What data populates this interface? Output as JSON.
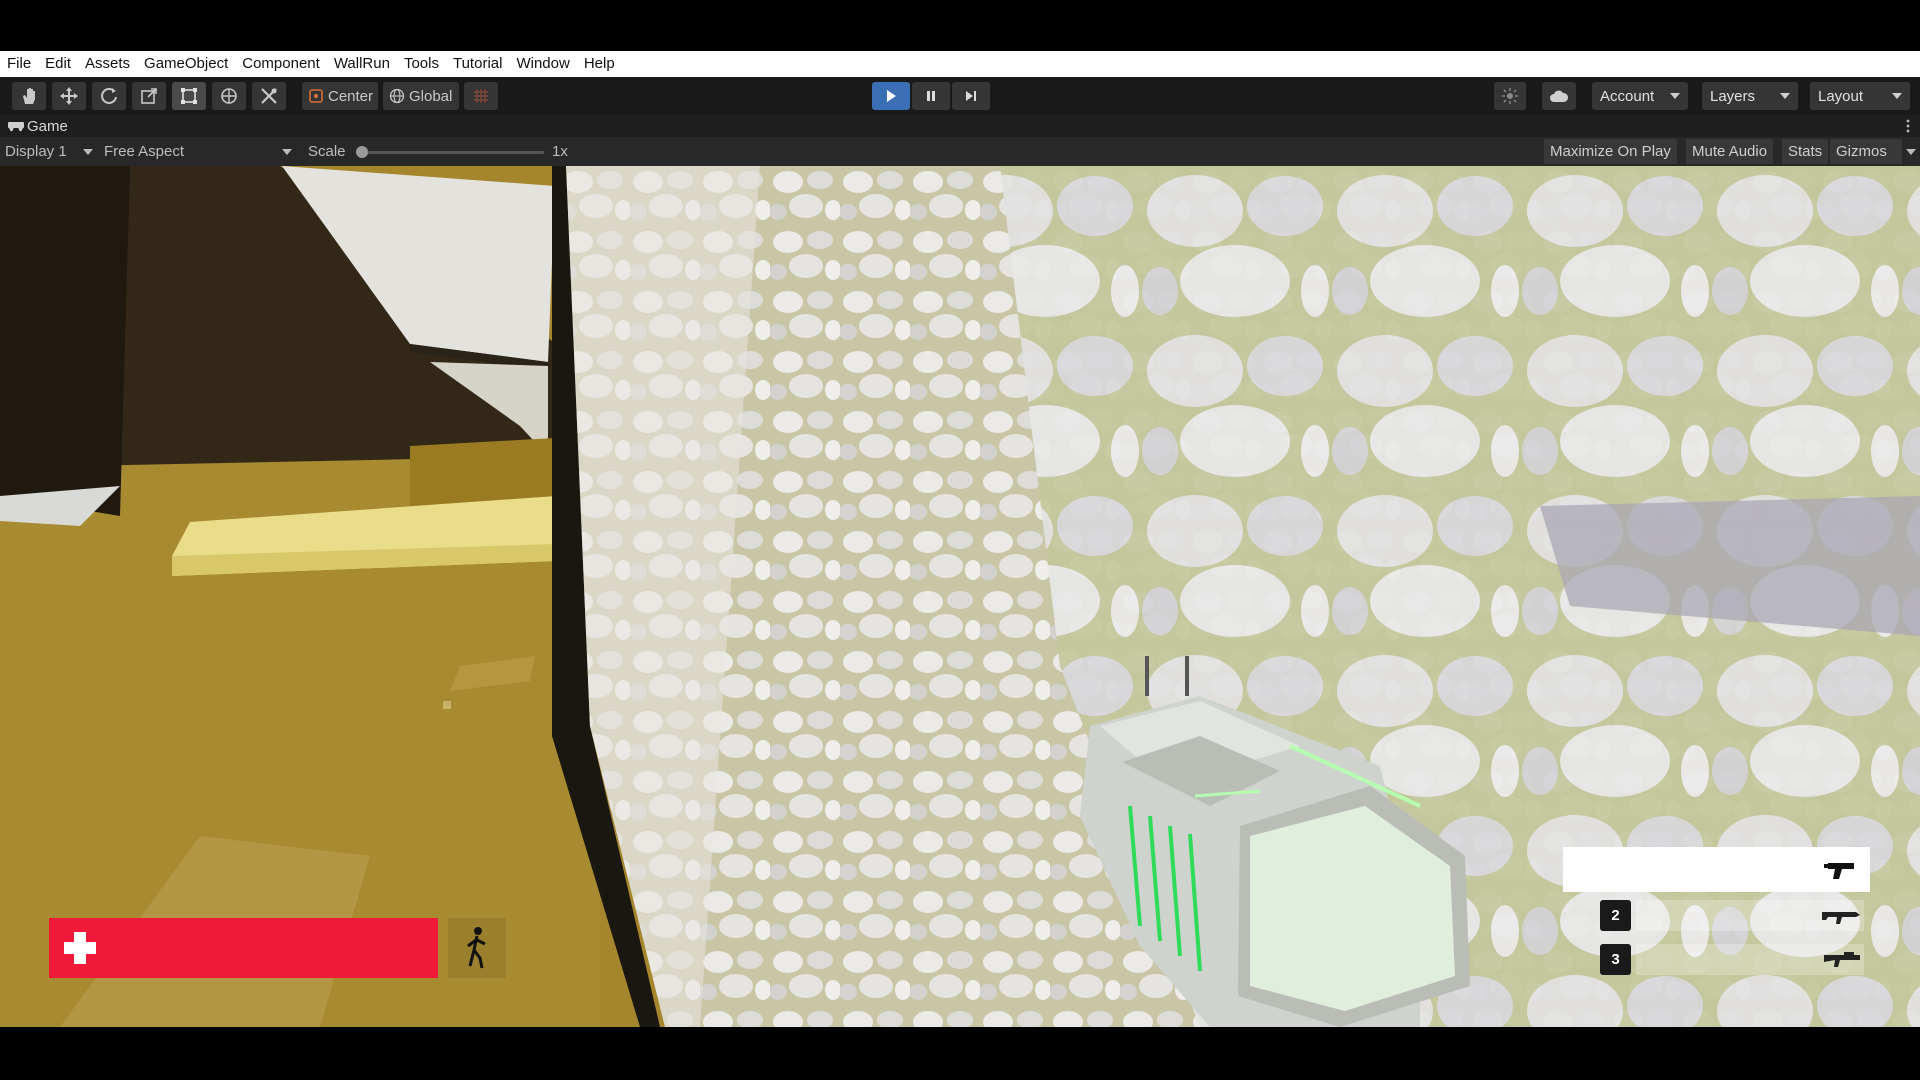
{
  "menu": [
    "File",
    "Edit",
    "Assets",
    "GameObject",
    "Component",
    "WallRun",
    "Tools",
    "Tutorial",
    "Window",
    "Help"
  ],
  "toolbar": {
    "tools": [
      "hand-tool",
      "move-tool",
      "rotate-tool",
      "scale-tool",
      "rect-tool",
      "transform-tool",
      "custom-tool"
    ],
    "pivot_label": "Center",
    "space_label": "Global",
    "account_label": "Account",
    "layers_label": "Layers",
    "layout_label": "Layout",
    "play_color": "#3b6fb5"
  },
  "game_view": {
    "tab_label": "Game",
    "display": "Display 1",
    "aspect": "Free Aspect",
    "scale_label": "Scale",
    "scale_value": "1x",
    "maximize": "Maximize On Play",
    "mute": "Mute Audio",
    "stats": "Stats",
    "gizmos": "Gizmos"
  },
  "hud": {
    "health_color": "#ef1a3a",
    "health_level": 1.0,
    "weapon_slots": [
      {
        "number": "",
        "selected": true,
        "icon": "pistol-icon"
      },
      {
        "number": "2",
        "selected": false,
        "icon": "rifle-icon"
      },
      {
        "number": "3",
        "selected": false,
        "icon": "shotgun-icon"
      }
    ]
  }
}
